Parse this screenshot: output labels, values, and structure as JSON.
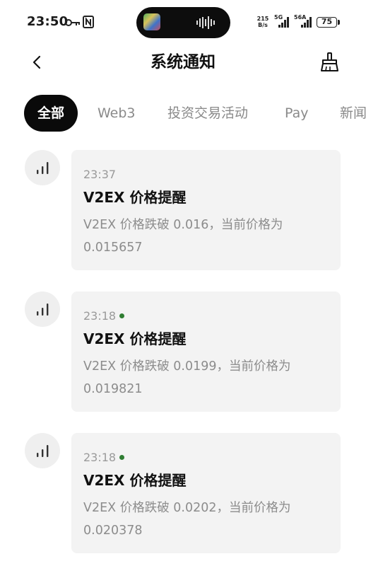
{
  "status_bar": {
    "time": "23:50",
    "speed_value": "215",
    "speed_unit": "B/s",
    "signal_1": "5G",
    "signal_2": "56A",
    "battery": "75"
  },
  "header": {
    "title": "系统通知"
  },
  "tabs": [
    {
      "label": "全部",
      "active": true
    },
    {
      "label": "Web3",
      "active": false
    },
    {
      "label": "投资交易活动",
      "active": false
    },
    {
      "label": "Pay",
      "active": false
    },
    {
      "label": "新闻",
      "active": false
    }
  ],
  "notifications": [
    {
      "time": "23:37",
      "unread": false,
      "title": "V2EX 价格提醒",
      "body": "V2EX 价格跌破 0.016，当前价格为 0.015657"
    },
    {
      "time": "23:18",
      "unread": true,
      "title": "V2EX 价格提醒",
      "body": "V2EX 价格跌破 0.0199，当前价格为 0.019821"
    },
    {
      "time": "23:18",
      "unread": true,
      "title": "V2EX 价格提醒",
      "body": "V2EX 价格跌破 0.0202，当前价格为 0.020378"
    }
  ],
  "icons": {
    "back": "chevron-left-icon",
    "clear": "broom-icon",
    "avatar": "signal-bars-icon",
    "status_key": "key-icon",
    "status_nfc": "nfc-icon"
  },
  "colors": {
    "active_tab_bg": "#0a0a0a",
    "card_bg": "#f3f3f3",
    "unread_dot": "#2f7d32",
    "muted_text": "#8c8c8c"
  }
}
